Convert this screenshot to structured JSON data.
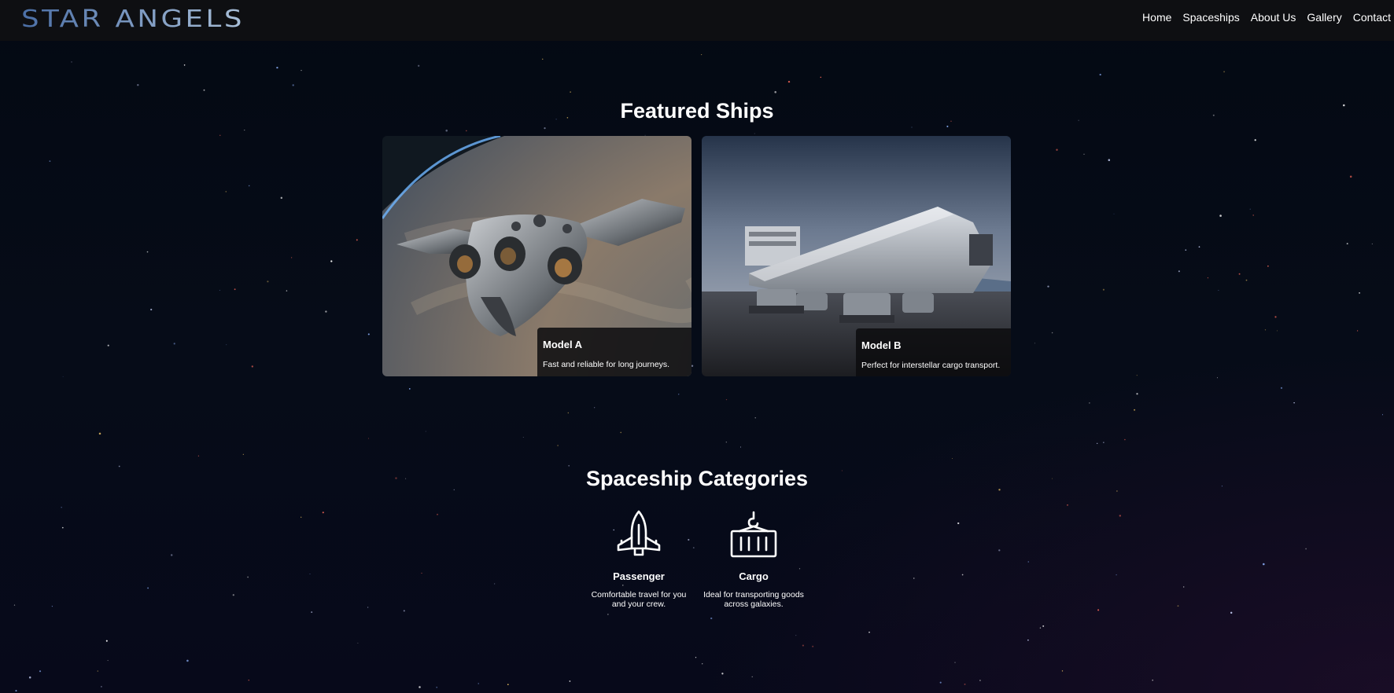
{
  "header": {
    "logo_text": "STAR ANGELS",
    "nav": [
      "Home",
      "Spaceships",
      "About Us",
      "Gallery",
      "Contact"
    ]
  },
  "featured": {
    "title": "Featured Ships",
    "cards": [
      {
        "name": "Model A",
        "description": "Fast and reliable for long journeys."
      },
      {
        "name": "Model B",
        "description": "Perfect for interstellar cargo transport."
      }
    ]
  },
  "categories": {
    "title": "Spaceship Categories",
    "items": [
      {
        "name": "Passenger",
        "description": "Comfortable travel for you and your crew.",
        "icon": "rocket-icon"
      },
      {
        "name": "Cargo",
        "description": "Ideal for transporting goods across galaxies.",
        "icon": "cargo-container-icon"
      }
    ]
  },
  "colors": {
    "background": "#050a15",
    "header_bg": "#0e0f12",
    "logo_gradient_start": "#4b6fa6",
    "logo_gradient_end": "#a9bfd8"
  }
}
